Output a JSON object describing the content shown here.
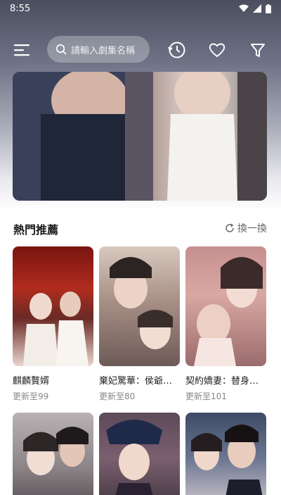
{
  "status": {
    "time": "8:55"
  },
  "search": {
    "placeholder": "請輸入劇集名稱"
  },
  "section": {
    "title": "熱門推薦",
    "refresh_label": "換一換"
  },
  "dramas": [
    {
      "title": "麒麟贅婿",
      "update": "更新至99"
    },
    {
      "title": "棄妃驚華：侯爺…",
      "update": "更新至80"
    },
    {
      "title": "契約嬌妻：替身…",
      "update": "更新至101"
    }
  ],
  "colors": {
    "accent": "#1b1b1b",
    "muted": "#888888"
  }
}
